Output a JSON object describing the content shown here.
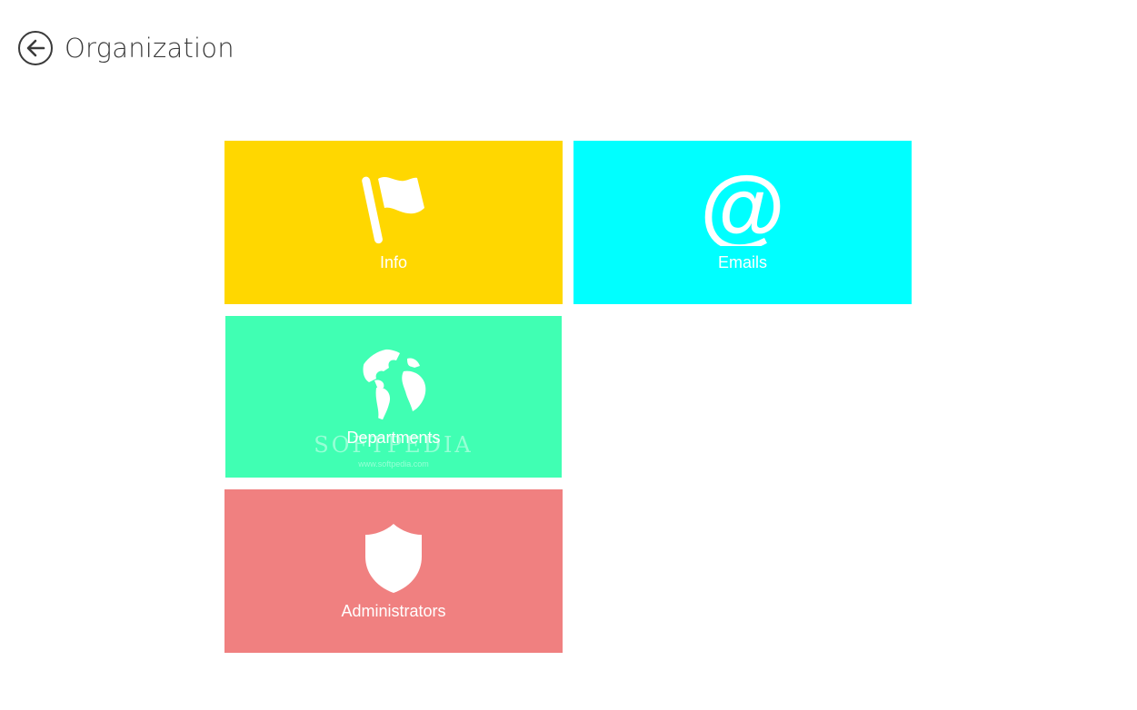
{
  "header": {
    "title": "Organization"
  },
  "tiles": [
    {
      "label": "Info",
      "icon": "flag-icon",
      "color": "#FFD700"
    },
    {
      "label": "Emails",
      "icon": "at-sign-icon",
      "color": "#00FFFF"
    },
    {
      "label": "Departments",
      "icon": "globe-icon",
      "color": "#40FFB3"
    },
    {
      "label": "Administrators",
      "icon": "shield-icon",
      "color": "#F08080"
    }
  ],
  "watermark": {
    "brand": "SOFTPEDIA",
    "url": "www.softpedia.com"
  }
}
